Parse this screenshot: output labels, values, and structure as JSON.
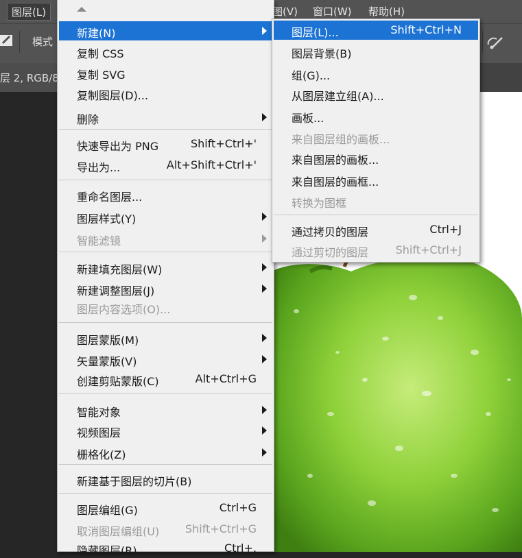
{
  "menubar": {
    "layer": "图层(L)",
    "view": "图(V)",
    "window": "窗口(W)",
    "help": "帮助(H)"
  },
  "options_bar": {
    "mode_label": "模式"
  },
  "doc_tab": {
    "title": "层 2, RGB/8"
  },
  "main_menu": {
    "items": [
      {
        "label": "新建(N)",
        "shortcut": "",
        "submenu": true,
        "enabled": true,
        "highlighted": true
      },
      {
        "label": "复制 CSS",
        "shortcut": "",
        "submenu": false,
        "enabled": true
      },
      {
        "label": "复制 SVG",
        "shortcut": "",
        "submenu": false,
        "enabled": true
      },
      {
        "label": "复制图层(D)...",
        "shortcut": "",
        "submenu": false,
        "enabled": true
      },
      {
        "label": "删除",
        "shortcut": "",
        "submenu": true,
        "enabled": true
      },
      {
        "label": "快速导出为 PNG",
        "shortcut": "Shift+Ctrl+'",
        "submenu": false,
        "enabled": true
      },
      {
        "label": "导出为...",
        "shortcut": "Alt+Shift+Ctrl+'",
        "submenu": false,
        "enabled": true
      },
      {
        "label": "重命名图层...",
        "shortcut": "",
        "submenu": false,
        "enabled": true
      },
      {
        "label": "图层样式(Y)",
        "shortcut": "",
        "submenu": true,
        "enabled": true
      },
      {
        "label": "智能滤镜",
        "shortcut": "",
        "submenu": true,
        "enabled": false
      },
      {
        "label": "新建填充图层(W)",
        "shortcut": "",
        "submenu": true,
        "enabled": true
      },
      {
        "label": "新建调整图层(J)",
        "shortcut": "",
        "submenu": true,
        "enabled": true
      },
      {
        "label": "图层内容选项(O)...",
        "shortcut": "",
        "submenu": false,
        "enabled": false
      },
      {
        "label": "图层蒙版(M)",
        "shortcut": "",
        "submenu": true,
        "enabled": true
      },
      {
        "label": "矢量蒙版(V)",
        "shortcut": "",
        "submenu": true,
        "enabled": true
      },
      {
        "label": "创建剪贴蒙版(C)",
        "shortcut": "Alt+Ctrl+G",
        "submenu": false,
        "enabled": true
      },
      {
        "label": "智能对象",
        "shortcut": "",
        "submenu": true,
        "enabled": true
      },
      {
        "label": "视频图层",
        "shortcut": "",
        "submenu": true,
        "enabled": true
      },
      {
        "label": "栅格化(Z)",
        "shortcut": "",
        "submenu": true,
        "enabled": true
      },
      {
        "label": "新建基于图层的切片(B)",
        "shortcut": "",
        "submenu": false,
        "enabled": true
      },
      {
        "label": "图层编组(G)",
        "shortcut": "Ctrl+G",
        "submenu": false,
        "enabled": true
      },
      {
        "label": "取消图层编组(U)",
        "shortcut": "Shift+Ctrl+G",
        "submenu": false,
        "enabled": false
      },
      {
        "label": "隐藏图层(R)",
        "shortcut": "Ctrl+,",
        "submenu": false,
        "enabled": true
      }
    ]
  },
  "sub_menu": {
    "items": [
      {
        "label": "图层(L)...",
        "shortcut": "Shift+Ctrl+N",
        "enabled": true,
        "highlighted": true
      },
      {
        "label": "图层背景(B)",
        "shortcut": "",
        "enabled": true
      },
      {
        "label": "组(G)...",
        "shortcut": "",
        "enabled": true
      },
      {
        "label": "从图层建立组(A)...",
        "shortcut": "",
        "enabled": true
      },
      {
        "label": "画板...",
        "shortcut": "",
        "enabled": true
      },
      {
        "label": "来自图层组的画板...",
        "shortcut": "",
        "enabled": false
      },
      {
        "label": "来自图层的画板...",
        "shortcut": "",
        "enabled": true
      },
      {
        "label": "来自图层的画框...",
        "shortcut": "",
        "enabled": true
      },
      {
        "label": "转换为图框",
        "shortcut": "",
        "enabled": false
      },
      {
        "label": "通过拷贝的图层",
        "shortcut": "Ctrl+J",
        "enabled": true
      },
      {
        "label": "通过剪切的图层",
        "shortcut": "Shift+Ctrl+J",
        "enabled": false
      }
    ]
  },
  "colors": {
    "menu_bg": "#f0f0f0",
    "highlight": "#1c73d4",
    "disabled_text": "#9a9a9a",
    "app_chrome": "#535353"
  }
}
